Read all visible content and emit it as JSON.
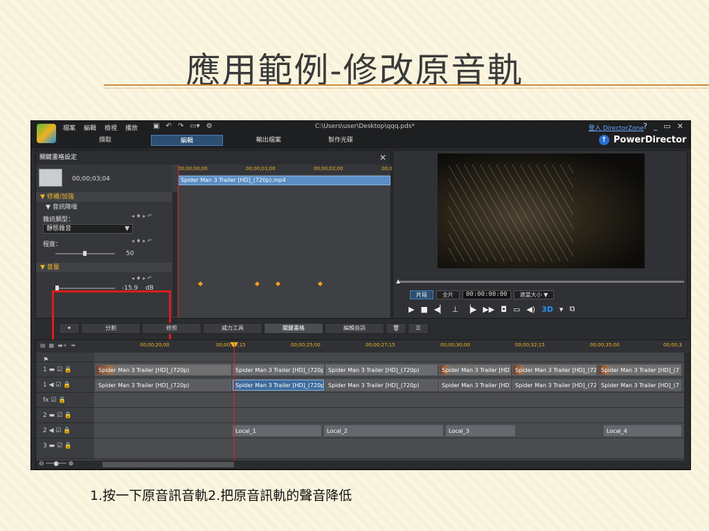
{
  "slide": {
    "title": "應用範例-修改原音軌",
    "caption": "1.按一下原音訊音軌2.把原音訊軌的聲音降低"
  },
  "app": {
    "menu": [
      "檔案",
      "編輯",
      "檢視",
      "播放"
    ],
    "file_path": "C:\\Users\\user\\Desktop\\qqq.pds*",
    "login_link": "登入 DirectorZone",
    "window_controls": [
      "?",
      "_",
      "▭",
      "✕"
    ],
    "modes": [
      {
        "label": "擷取",
        "active": false
      },
      {
        "label": "編輯",
        "active": true
      },
      {
        "label": "輸出檔案",
        "active": false
      },
      {
        "label": "製作光碟",
        "active": false
      }
    ],
    "brand": "PowerDirector",
    "accent_color": "#f0b429"
  },
  "keyframe_panel": {
    "title": "關鍵畫格設定",
    "close": "✕",
    "clip_time": "00;00;03;04",
    "ruler_ticks": [
      "00;00;00;00",
      "00;00;01;00",
      "00;00;02;00",
      "00;0"
    ],
    "clip_name": "Spider Man 3 Trailer [HD]_(720p).mp4",
    "section_fix": "修補/加強",
    "subsection_noise": "音訊降噪",
    "noise_type_label": "雜訊類型：",
    "noise_type_value": "靜態雜音",
    "degree_label": "程度：",
    "degree_value": "50",
    "section_volume": "音量",
    "volume_value": "-15.9",
    "volume_unit": "dB"
  },
  "preview": {
    "btn_clip": "片段",
    "btn_movie": "全片",
    "timecode": "00:00:00:00",
    "fit": "適當大小 ▼",
    "three_d": "3D"
  },
  "tabs": [
    {
      "label": "分割",
      "active": false
    },
    {
      "label": "修剪",
      "active": false
    },
    {
      "label": "威力工具",
      "active": false
    },
    {
      "label": "關鍵畫格",
      "active": true
    },
    {
      "label": "編輯音訊",
      "active": false
    }
  ],
  "timeline": {
    "ruler_ticks": [
      "00;00;20;00",
      "00;00;22;15",
      "00;00;25;00",
      "00;00;27;15",
      "00;00;30;00",
      "00;00;32;15",
      "00;00;35;00",
      "00;00;3"
    ],
    "tracks": [
      {
        "label": "1 ▬ ☑ 🔒"
      },
      {
        "label": "1 ◀ ☑ 🔒"
      },
      {
        "label": "fx ☑ 🔒"
      },
      {
        "label": "2 ▬ ☑ 🔒"
      },
      {
        "label": "2 ◀ ☑ 🔒"
      },
      {
        "label": "3 ▬ ☑ 🔒"
      }
    ],
    "video_clip": "Spider Man 3 Trailer [HD]_(720p)",
    "video_clip_short": "Spider Man 3 Trailer [HD]_",
    "video_clip_cut": "Spider Man 3 Trailer [HD]_(720",
    "video_clip_end": "Spider Man 3 Trailer [HD]_(7",
    "audio_clip": "Spider Man 3 Trailer [HD]_(720p)",
    "audio_clip_sel": "Spider Man 3 Trailer [HD]_(720p",
    "audio_clip_short": "Spider Man 3 Trailer [HD]_",
    "audio_clip_cut": "Spider Man 3 Trailer [HD]_(720",
    "audio_clip_end": "Spider Man 3 Trailer [HD]_(7",
    "local_clips": [
      "Local_1",
      "Local_2",
      "Local_3",
      "Local_4"
    ]
  }
}
